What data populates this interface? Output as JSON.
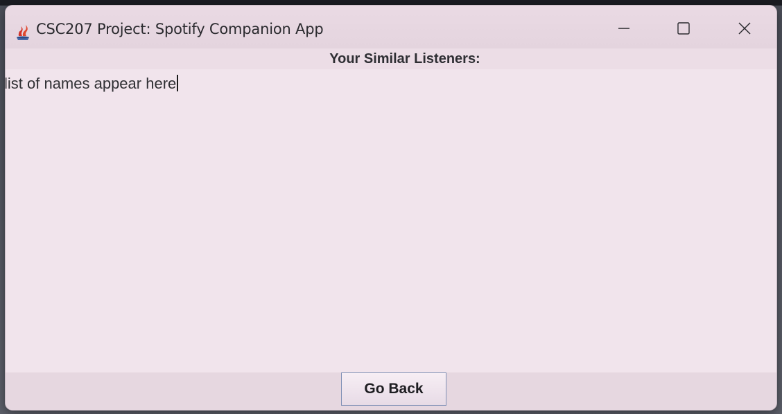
{
  "window": {
    "title": "CSC207 Project: Spotify Companion App",
    "icon": "java-coffee-icon"
  },
  "controls": {
    "minimize_icon": "minimize-icon",
    "maximize_icon": "maximize-icon",
    "close_icon": "close-icon"
  },
  "main": {
    "heading": "Your Similar Listeners:",
    "names_text": "list of names appear here"
  },
  "footer": {
    "go_back_label": "Go Back"
  },
  "colors": {
    "window_bg": "#ecdde6",
    "button_border": "#7e8fb5",
    "text": "#2e2e33"
  }
}
